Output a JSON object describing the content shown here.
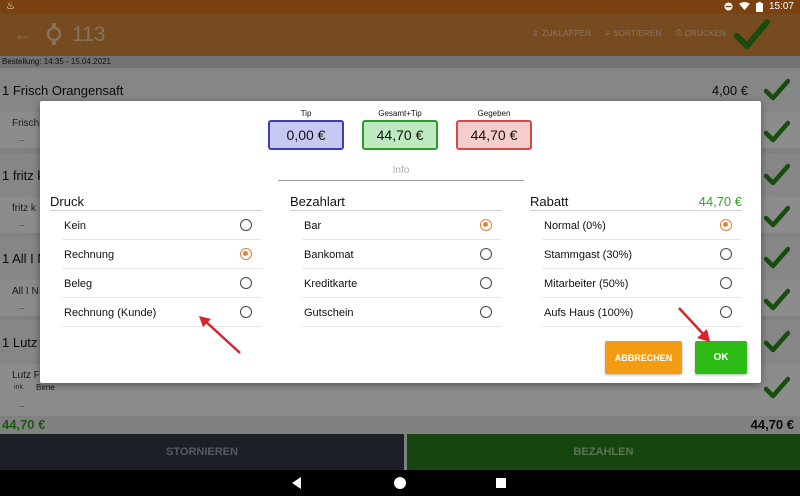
{
  "status_bar": {
    "time": "15:07"
  },
  "app_bar": {
    "table_number": "113",
    "actions": {
      "collapse": "ZUKLAPPEN",
      "sort": "SORTIEREN",
      "print": "DRUCKEN"
    }
  },
  "order_info": "Bestellung: 14:35 - 15.04.2021",
  "order_items": [
    {
      "name": "1 Frisch Orangensaft",
      "price": "4,00 €",
      "sub": "Frisch"
    },
    {
      "name": "1 fritz k",
      "price": "",
      "sub": "fritz k"
    },
    {
      "name": "1 All I N",
      "price": "",
      "sub": "All I N"
    },
    {
      "name": "1 Lutz",
      "price": "",
      "sub": "Lutz F",
      "note_a": "ink.",
      "note_b": "Birne"
    }
  ],
  "sub_dots": "...",
  "totals": {
    "left": "44,70 €",
    "right": "44,70 €"
  },
  "bottom_buttons": {
    "cancel": "STORNIEREN",
    "pay": "BEZAHLEN"
  },
  "dialog": {
    "tip_label": "Tip",
    "tip_value": "0,00 €",
    "total_label": "Gesamt+Tip",
    "total_value": "44,70 €",
    "given_label": "Gegeben",
    "given_value": "44,70 €",
    "info_label": "Info",
    "print": {
      "title": "Druck",
      "options": [
        "Kein",
        "Rechnung",
        "Beleg",
        "Rechnung (Kunde)"
      ]
    },
    "payment": {
      "title": "Bezahlart",
      "options": [
        "Bar",
        "Bankomat",
        "Kreditkarte",
        "Gutschein"
      ]
    },
    "discount": {
      "title": "Rabatt",
      "value": "44,70 €",
      "options": [
        "Normal (0%)",
        "Stammgast (30%)",
        "Mitarbeiter (50%)",
        "Aufs Haus (100%)"
      ]
    },
    "cancel_label": "ABBRECHEN",
    "ok_label": "OK"
  },
  "colors": {
    "app_bar": "#d8893b",
    "accent_green": "#2dbb15",
    "cancel_orange": "#f39c12",
    "radio_selected": "#e0833a"
  },
  "icons": [
    "back-arrow-icon",
    "table-icon",
    "collapse-icon",
    "sort-icon",
    "printer-icon",
    "checkmark-icon",
    "wifi-icon",
    "battery-icon"
  ]
}
